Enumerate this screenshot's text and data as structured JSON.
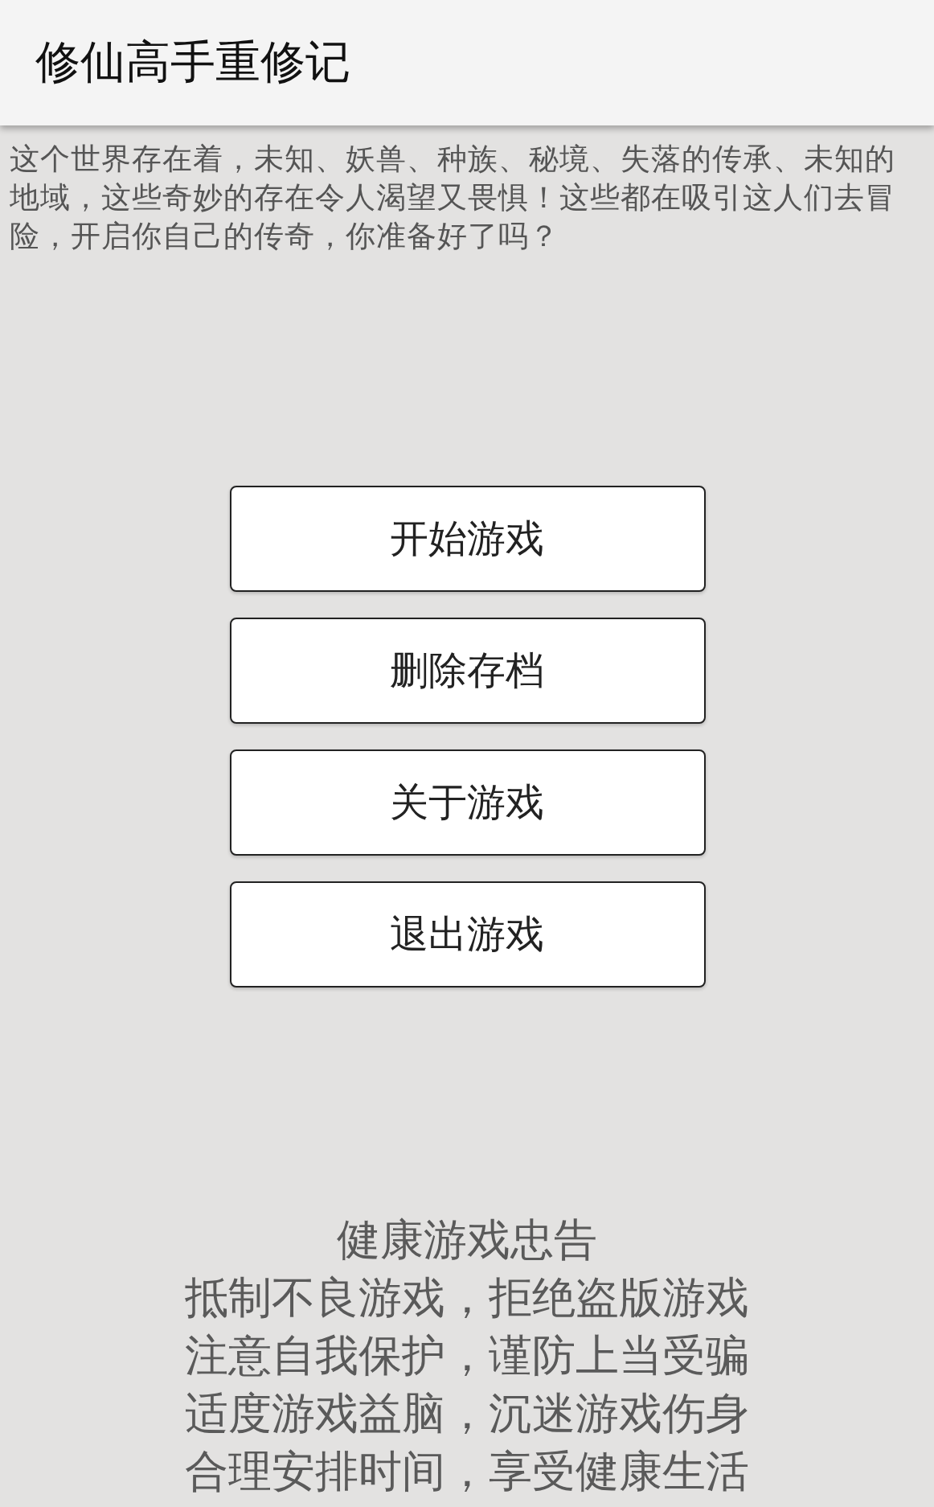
{
  "app_bar": {
    "title": "修仙高手重修记"
  },
  "intro": "这个世界存在着，未知、妖兽、种族、秘境、失落的传承、未知的地域，这些奇妙的存在令人渴望又畏惧！这些都在吸引这人们去冒险，开启你自己的传奇，你准备好了吗？",
  "buttons": [
    "开始游戏",
    "删除存档",
    "关于游戏",
    "退出游戏"
  ],
  "notice": {
    "title": "健康游戏忠告",
    "lines": [
      "抵制不良游戏，拒绝盗版游戏",
      "注意自我保护，谨防上当受骗",
      "适度游戏益脑，沉迷游戏伤身",
      "合理安排时间，享受健康生活"
    ]
  }
}
